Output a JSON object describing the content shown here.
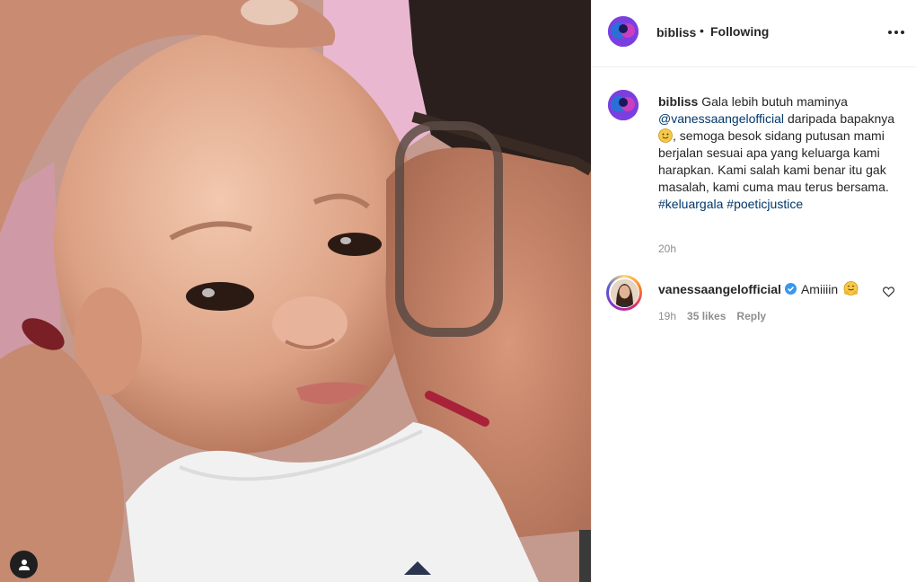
{
  "photo": {
    "tag_icon": "user-silhouette-icon",
    "description_colors": {
      "skin": "#d9a58a",
      "background": "#c89a86",
      "onesie": "#f3f3f3",
      "pillow": "#e8b6cf"
    }
  },
  "header": {
    "username": "bibliss",
    "separator": "•",
    "follow_label": "Following",
    "more_icon": "more-horizontal-icon"
  },
  "caption": {
    "username": "bibliss",
    "text_1": "Gala lebih butuh maminya",
    "mention": "@vanessaangelofficial",
    "text_2": "daripada bapaknya",
    "emoji": "slightly-smiling-face",
    "text_3": ", semoga besok sidang putusan mami berjalan sesuai apa yang keluarga kami harapkan. Kami salah kami benar itu gak masalah, kami cuma mau terus bersama.",
    "hashtag_1": "#keluargala",
    "hashtag_2": "#poeticjustice",
    "time": "20h"
  },
  "comments": [
    {
      "username": "vanessaangelofficial",
      "verified": true,
      "text": "Amiiiin",
      "emoji": "hugging-face",
      "time": "19h",
      "likes": "35 likes",
      "reply_label": "Reply",
      "like_icon": "heart-outline-icon"
    }
  ],
  "colors": {
    "text": "#262626",
    "muted": "#8e8e8e",
    "link": "#00376b",
    "verified": "#3897f0",
    "border": "#efefef"
  }
}
